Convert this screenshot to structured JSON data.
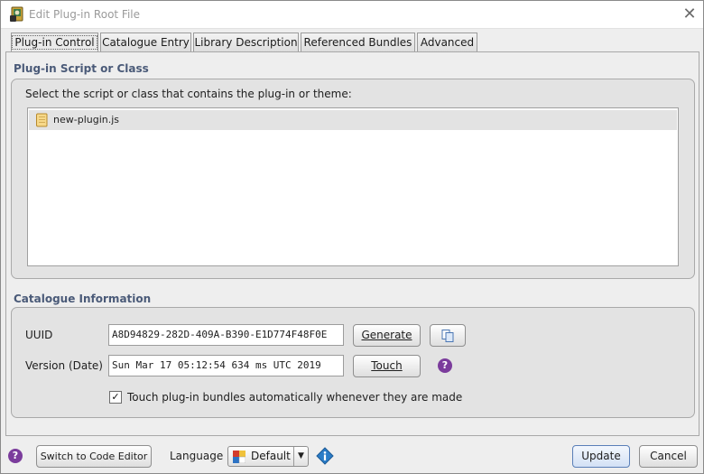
{
  "window": {
    "title": "Edit Plug-in Root File",
    "close_icon": "close-icon"
  },
  "tabs": [
    {
      "label": "Plug-in Control",
      "active": true
    },
    {
      "label": "Catalogue Entry",
      "active": false
    },
    {
      "label": "Library Description",
      "active": false
    },
    {
      "label": "Referenced Bundles",
      "active": false
    },
    {
      "label": "Advanced",
      "active": false
    }
  ],
  "script_section": {
    "title": "Plug-in Script or Class",
    "instruction": "Select the script or class that contains the plug-in or theme:",
    "files": [
      {
        "name": "new-plugin.js",
        "icon": "script-file-icon",
        "selected": true
      }
    ]
  },
  "catalogue_section": {
    "title": "Catalogue Information",
    "uuid_label": "UUID",
    "uuid_value": "A8D94829-282D-409A-B390-E1D774F48F0E",
    "generate_label": "Generate",
    "copy_icon": "copy-icon",
    "version_label": "Version (Date)",
    "version_value": "Sun Mar 17 05:12:54 634 ms UTC 2019",
    "touch_label": "Touch",
    "help_icon": "help-icon",
    "auto_touch_label": "Touch plug-in bundles automatically whenever they are made",
    "auto_touch_checked": true
  },
  "footer": {
    "help_icon": "help-icon",
    "code_editor_label": "Switch to Code Editor",
    "language_label": "Language",
    "language_value": "Default",
    "info_icon": "info-icon",
    "update_label": "Update",
    "cancel_label": "Cancel"
  },
  "colors": {
    "accent_button": "#d3e1f5",
    "group_title": "#4a5a78",
    "help_badge": "#7b3c9c",
    "info_badge": "#2a7cc7",
    "selection_row": "#e3e3e3"
  }
}
